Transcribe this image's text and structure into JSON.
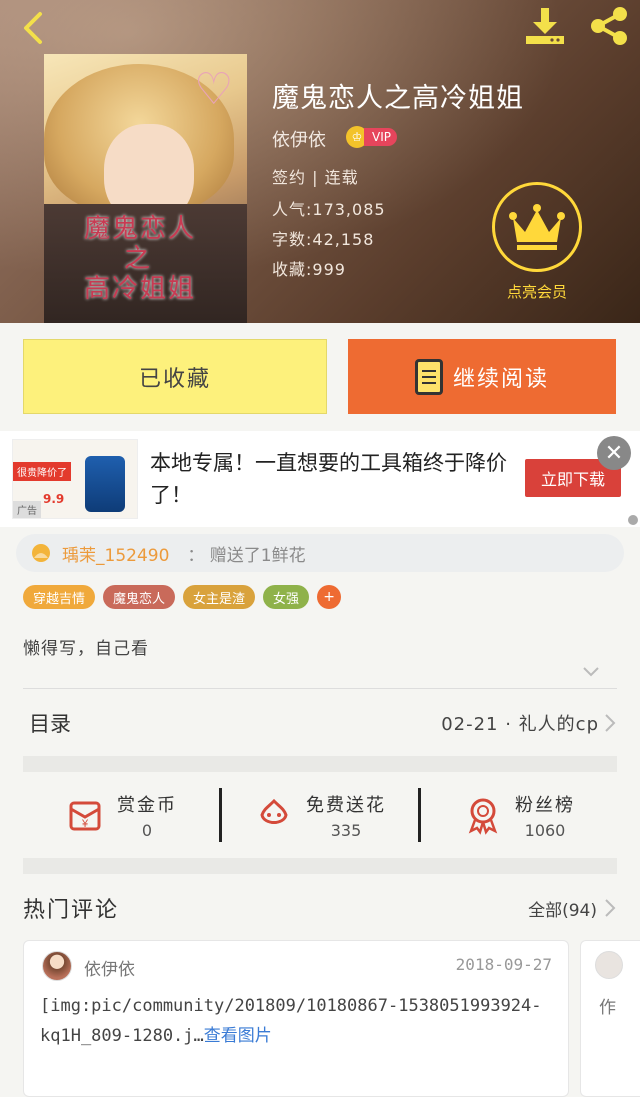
{
  "book": {
    "title": "魔鬼恋人之高冷姐姐",
    "author": "依伊依",
    "vip": "VIP",
    "status": "签约 | 连载",
    "popularity": "人气:173,085",
    "words": "字数:42,158",
    "favorites": "收藏:999",
    "cover_text_line1": "魔鬼恋人",
    "cover_text_line2": "之",
    "cover_text_line3": "高冷姐姐"
  },
  "member": {
    "label": "点亮会员"
  },
  "actions": {
    "favorite_label": "已收藏",
    "read_label": "继续阅读"
  },
  "ad": {
    "text": "本地专属！一直想要的工具箱终于降价了！",
    "thumb_promo": "很贵降价了",
    "thumb_price": "9.9",
    "thumb_tag": "广告",
    "cta": "立即下载",
    "close": "✕"
  },
  "gift": {
    "user": "瑀茉_152490",
    "message": "：  赠送了1鲜花"
  },
  "tags": [
    {
      "label": "穿越吉情",
      "color": "#f0a93b"
    },
    {
      "label": "魔鬼恋人",
      "color": "#c96a5a"
    },
    {
      "label": "女主是渣",
      "color": "#d9a23c"
    },
    {
      "label": "女强",
      "color": "#8fb24a"
    }
  ],
  "tag_more": "+",
  "intro": "懒得写，自己看",
  "toc": {
    "label": "目录",
    "latest": "02-21 · 礼人的cp"
  },
  "stats": [
    {
      "label": "赏金币",
      "value": "0"
    },
    {
      "label": "免费送花",
      "value": "335"
    },
    {
      "label": "粉丝榜",
      "value": "1060"
    }
  ],
  "comments_section": {
    "title": "热门评论",
    "all_label": "全部(94)"
  },
  "comments": [
    {
      "user": "依伊依",
      "date": "2018-09-27",
      "body": "[img:pic/community/201809/10180867-1538051993924-kq1H_809-1280.j…",
      "link": "查看图片"
    },
    {
      "user": "作"
    }
  ],
  "colors": {
    "accent_orange": "#ee6b32",
    "fav_yellow": "#fdf17c",
    "member_gold": "#ffd83a"
  }
}
